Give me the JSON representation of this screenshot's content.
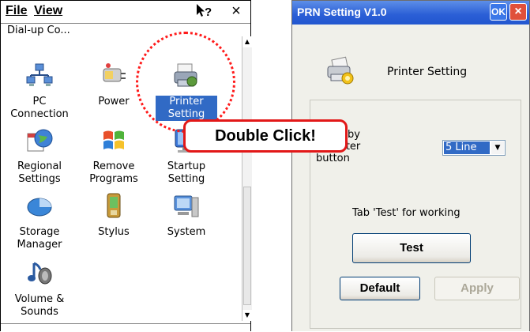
{
  "left_window": {
    "menu": {
      "file": "File",
      "view": "View"
    },
    "help_icon": "?",
    "close_icon": "×",
    "partial_item": "Dial-up Co...",
    "items": [
      {
        "label": "PC\nConnection",
        "icon": "pc-connection-icon"
      },
      {
        "label": "Power",
        "icon": "power-icon"
      },
      {
        "label": "Printer\nSetting",
        "icon": "printer-setting-icon",
        "selected": true
      },
      {
        "label": "Regional\nSettings",
        "icon": "regional-settings-icon"
      },
      {
        "label": "Remove\nPrograms",
        "icon": "remove-programs-icon"
      },
      {
        "label": "Startup\nSetting",
        "icon": "startup-setting-icon"
      },
      {
        "label": "Storage\nManager",
        "icon": "storage-manager-icon"
      },
      {
        "label": "Stylus",
        "icon": "stylus-icon"
      },
      {
        "label": "System",
        "icon": "system-icon"
      },
      {
        "label": "Volume &\nSounds",
        "icon": "volume-sounds-icon"
      }
    ]
  },
  "callout": {
    "text": "Double Click!",
    "color": "#e21818"
  },
  "right_window": {
    "title": "PRN Setting V1.0",
    "ok_label": "OK",
    "close_label": "×",
    "header_label": "Printer  Setting",
    "feed_label": "g line by\ng printer\nbutton",
    "feed_value": "5 Line",
    "tab_hint": "Tab 'Test' for working",
    "test_label": "Test",
    "default_label": "Default",
    "apply_label": "Apply",
    "title_color": "#2a5ed6",
    "selection_color": "#316ac5"
  }
}
